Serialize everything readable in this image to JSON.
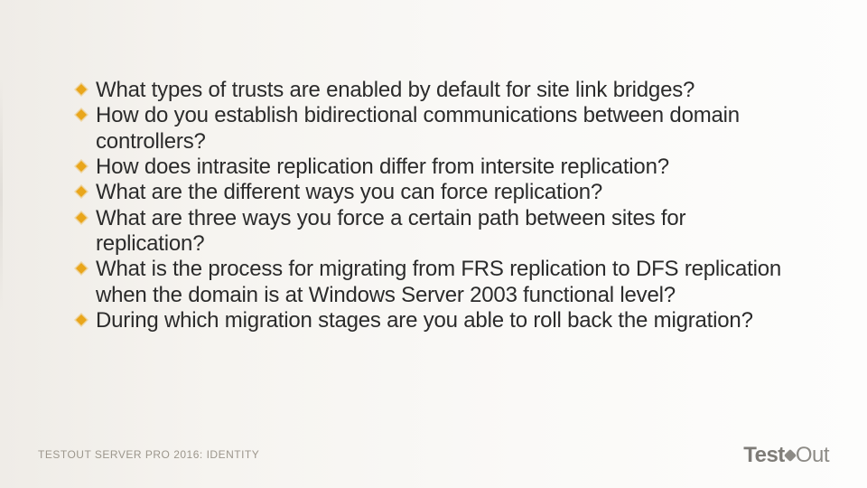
{
  "bullets": [
    "What types of trusts are enabled by default for site link bridges?",
    "How do you establish bidirectional communications between domain controllers?",
    "How does intrasite replication differ from intersite replication?",
    "What are the different ways you can force replication?",
    "What are three ways you force a certain path between sites for replication?",
    "What is the process for migrating from FRS replication to DFS replication when the domain is at Windows Server 2003 functional level?",
    "During which migration stages are you able to roll back the migration?"
  ],
  "footer": {
    "left": "TESTOUT SERVER PRO 2016: IDENTITY",
    "brand_bold": "Test",
    "brand_light": "Out"
  },
  "icon_name": "diamond-bullet-icon"
}
